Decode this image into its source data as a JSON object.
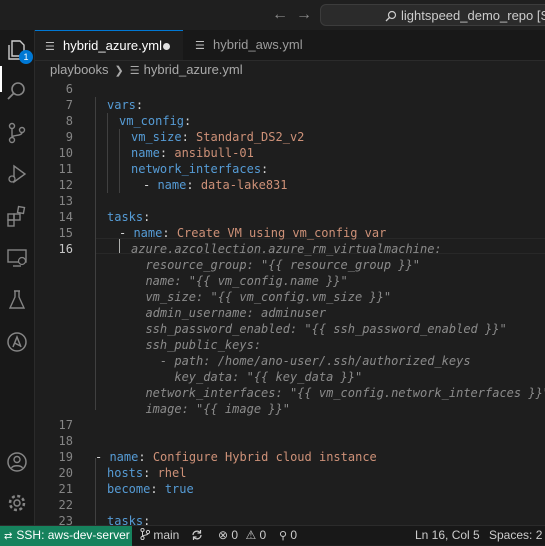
{
  "titlebar": {
    "back_arrow": "←",
    "forward_arrow": "→",
    "search_text": "lightspeed_demo_repo [SSH:"
  },
  "activity_bar": {
    "icons": [
      "explorer-icon",
      "search-icon",
      "source-control-icon",
      "run-debug-icon",
      "extensions-icon",
      "remote-explorer-icon",
      "testing-icon",
      "ansible-icon",
      "account-icon",
      "settings-gear-icon"
    ],
    "explorer_badge": "1",
    "accent_color": "#0078d4"
  },
  "tabs": [
    {
      "label": "hybrid_azure.yml",
      "active": true,
      "modified": true
    },
    {
      "label": "hybrid_aws.yml",
      "active": false
    }
  ],
  "breadcrumb": {
    "folder": "playbooks",
    "file": "hybrid_azure.yml"
  },
  "editor": {
    "current_line": "16",
    "line_numbers": [
      "6",
      "7",
      "8",
      "9",
      "10",
      "11",
      "12",
      "13",
      "14",
      "15",
      "16",
      "17",
      "18",
      "19",
      "20",
      "21",
      "22",
      "23"
    ],
    "lines": {
      "l7_key": "vars",
      "l8_key": "vm_config",
      "l9_key": "vm_size",
      "l9_val": "Standard_DS2_v2",
      "l10_key": "name",
      "l10_val": "ansibull-01",
      "l11_key": "network_interfaces",
      "l12_dash": "- ",
      "l12_key": "name",
      "l12_val": "data-lake831",
      "l14_key": "tasks",
      "l15_dash": "- ",
      "l15_key": "name",
      "l15_val": "Create VM using vm_config var",
      "l19_dash": "- ",
      "l19_key": "name",
      "l19_val": "Configure Hybrid cloud instance",
      "l20_key": "hosts",
      "l20_val": "rhel",
      "l21_key": "become",
      "l21_val": "true",
      "l23_key": "tasks"
    },
    "suggestion": [
      "azure.azcollection.azure_rm_virtualmachine:",
      "  resource_group: \"{{ resource_group }}\"",
      "  name: \"{{ vm_config.name }}\"",
      "  vm_size: \"{{ vm_config.vm_size }}\"",
      "  admin_username: adminuser",
      "  ssh_password_enabled: \"{{ ssh_password_enabled }}\"",
      "  ssh_public_keys:",
      "    - path: /home/ano-user/.ssh/authorized_keys",
      "      key_data: \"{{ key_data }}\"",
      "  network_interfaces: \"{{ vm_config.network_interfaces }}\"",
      "  image: \"{{ image }}\""
    ]
  },
  "statusbar": {
    "remote": "SSH: aws-dev-server",
    "branch": "main",
    "errors": "0",
    "warnings": "0",
    "ports": "0",
    "cursor_pos": "Ln 16, Col 5",
    "indent": "Spaces: 2",
    "remote_color": "#16825d"
  }
}
